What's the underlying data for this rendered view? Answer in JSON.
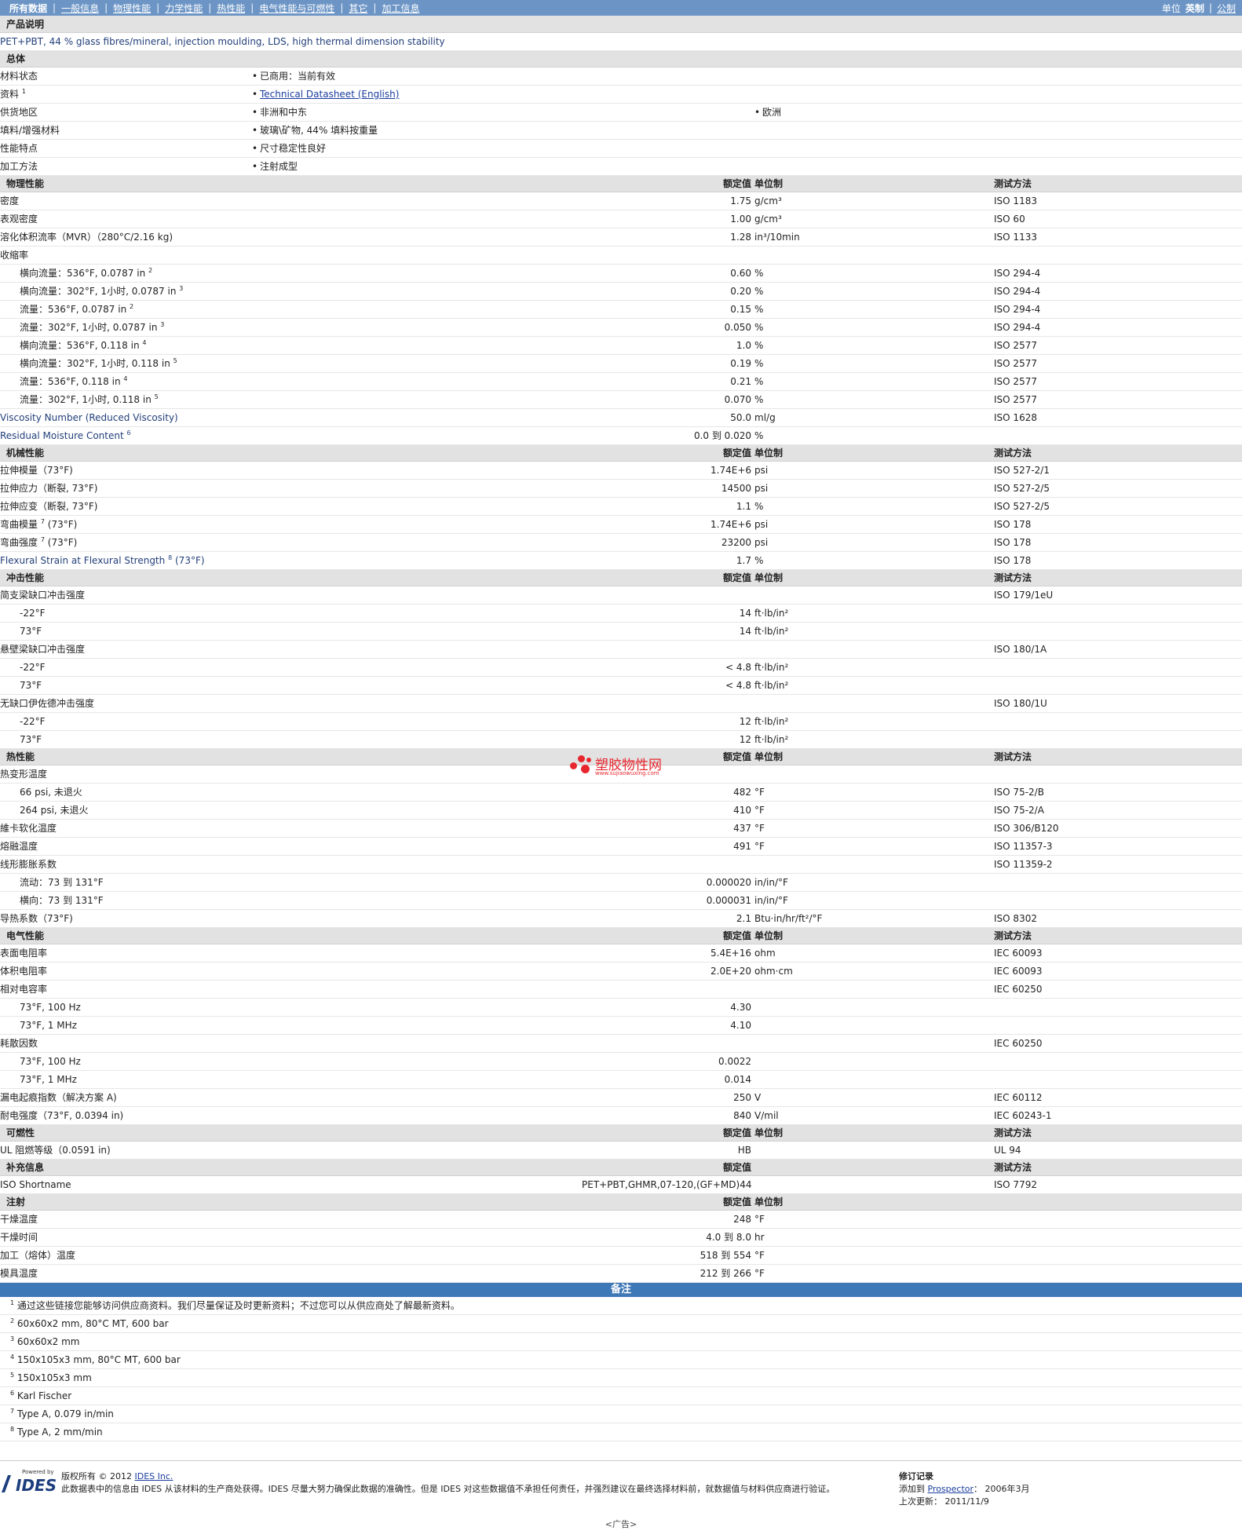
{
  "nav": {
    "tabs": [
      "所有数据",
      "一般信息",
      "物理性能",
      "力学性能",
      "热性能",
      "电气性能与可燃性",
      "其它",
      "加工信息"
    ],
    "units_label": "单位",
    "unit_active": "英制",
    "unit_alt": "公制"
  },
  "header": {
    "value": "额定值",
    "unit": "单位制",
    "method": "测试方法"
  },
  "product": {
    "title": "产品说明",
    "desc": "PET+PBT, 44 % glass fibres/mineral, injection moulding, LDS, high thermal dimension stability"
  },
  "general": {
    "title": "总体",
    "rows": [
      {
        "label": "材料状态",
        "sup": "",
        "v1": "已商用：当前有效",
        "v2": ""
      },
      {
        "label": "资料",
        "sup": "1",
        "v1": "Technical Datasheet (English)",
        "v2": ""
      },
      {
        "label": "供货地区",
        "sup": "",
        "v1": "非洲和中东",
        "v2": "欧洲"
      },
      {
        "label": "填料/增强材料",
        "sup": "",
        "v1": "玻璃\\矿物, 44% 填料按重量",
        "v2": ""
      },
      {
        "label": "性能特点",
        "sup": "",
        "v1": "尺寸稳定性良好",
        "v2": ""
      },
      {
        "label": "加工方法",
        "sup": "",
        "v1": "注射成型",
        "v2": ""
      }
    ]
  },
  "sections": [
    {
      "title": "物理性能",
      "showUnit": true,
      "rows": [
        {
          "label": "密度",
          "value": "1.75",
          "unit": "g/cm³",
          "method": "ISO 1183"
        },
        {
          "label": "表观密度",
          "value": "1.00",
          "unit": "g/cm³",
          "method": "ISO 60"
        },
        {
          "label": "溶化体积流率（MVR）（280°C/2.16 kg)",
          "value": "1.28",
          "unit": "in³/10min",
          "method": "ISO 1133"
        },
        {
          "label": "收缩率",
          "value": "",
          "unit": "",
          "method": ""
        },
        {
          "label": "横向流量：536°F, 0.0787 in",
          "sup": "2",
          "value": "0.60",
          "unit": "%",
          "method": "ISO 294-4",
          "indent": true
        },
        {
          "label": "横向流量：302°F, 1小时, 0.0787 in",
          "sup": "3",
          "value": "0.20",
          "unit": "%",
          "method": "ISO 294-4",
          "indent": true
        },
        {
          "label": "流量：536°F, 0.0787 in",
          "sup": "2",
          "value": "0.15",
          "unit": "%",
          "method": "ISO 294-4",
          "indent": true
        },
        {
          "label": "流量：302°F, 1小时, 0.0787 in",
          "sup": "3",
          "value": "0.050",
          "unit": "%",
          "method": "ISO 294-4",
          "indent": true
        },
        {
          "label": "横向流量：536°F, 0.118 in",
          "sup": "4",
          "value": "1.0",
          "unit": "%",
          "method": "ISO 2577",
          "indent": true
        },
        {
          "label": "横向流量：302°F, 1小时, 0.118 in",
          "sup": "5",
          "value": "0.19",
          "unit": "%",
          "method": "ISO 2577",
          "indent": true
        },
        {
          "label": "流量：536°F, 0.118 in",
          "sup": "4",
          "value": "0.21",
          "unit": "%",
          "method": "ISO 2577",
          "indent": true
        },
        {
          "label": "流量：302°F, 1小时, 0.118 in",
          "sup": "5",
          "value": "0.070",
          "unit": "%",
          "method": "ISO 2577",
          "indent": true
        },
        {
          "label": "Viscosity Number (Reduced Viscosity)",
          "value": "50.0",
          "unit": "ml/g",
          "method": "ISO 1628",
          "blue": true
        },
        {
          "label": "Residual Moisture Content",
          "sup": "6",
          "value": "0.0 到  0.020",
          "unit": "%",
          "method": "",
          "blue": true
        }
      ]
    },
    {
      "title": "机械性能",
      "showUnit": true,
      "rows": [
        {
          "label": "拉伸模量（73°F)",
          "value": "1.74E+6",
          "unit": "psi",
          "method": "ISO 527-2/1"
        },
        {
          "label": "拉伸应力（断裂, 73°F)",
          "value": "14500",
          "unit": "psi",
          "method": "ISO 527-2/5"
        },
        {
          "label": "拉伸应变（断裂, 73°F)",
          "value": "1.1",
          "unit": "%",
          "method": "ISO 527-2/5"
        },
        {
          "label": "弯曲模量",
          "sup": "7",
          "label2": "(73°F)",
          "value": "1.74E+6",
          "unit": "psi",
          "method": "ISO 178"
        },
        {
          "label": "弯曲强度",
          "sup": "7",
          "label2": "(73°F)",
          "value": "23200",
          "unit": "psi",
          "method": "ISO 178"
        },
        {
          "label": "Flexural Strain at Flexural Strength",
          "sup": "8",
          "label2": "(73°F)",
          "value": "1.7",
          "unit": "%",
          "method": "ISO 178",
          "blue": true
        }
      ]
    },
    {
      "title": "冲击性能",
      "showUnit": true,
      "rows": [
        {
          "label": "简支梁缺口冲击强度",
          "value": "",
          "unit": "",
          "method": "ISO 179/1eU"
        },
        {
          "label": "-22°F",
          "value": "14",
          "unit": "ft·lb/in²",
          "method": "",
          "indent": true
        },
        {
          "label": "73°F",
          "value": "14",
          "unit": "ft·lb/in²",
          "method": "",
          "indent": true
        },
        {
          "label": "悬壁梁缺口冲击强度",
          "value": "",
          "unit": "",
          "method": "ISO 180/1A"
        },
        {
          "label": "-22°F",
          "value": "< 4.8",
          "unit": "ft·lb/in²",
          "method": "",
          "indent": true
        },
        {
          "label": "73°F",
          "value": "< 4.8",
          "unit": "ft·lb/in²",
          "method": "",
          "indent": true
        },
        {
          "label": "无缺口伊佐德冲击强度",
          "value": "",
          "unit": "",
          "method": "ISO 180/1U"
        },
        {
          "label": "-22°F",
          "value": "12",
          "unit": "ft·lb/in²",
          "method": "",
          "indent": true
        },
        {
          "label": "73°F",
          "value": "12",
          "unit": "ft·lb/in²",
          "method": "",
          "indent": true
        }
      ]
    },
    {
      "title": "热性能",
      "showUnit": true,
      "rows": [
        {
          "label": "热变形温度",
          "value": "",
          "unit": "",
          "method": ""
        },
        {
          "label": "66 psi, 未退火",
          "value": "482",
          "unit": "°F",
          "method": "ISO 75-2/B",
          "indent": true
        },
        {
          "label": "264 psi, 未退火",
          "value": "410",
          "unit": "°F",
          "method": "ISO 75-2/A",
          "indent": true
        },
        {
          "label": "維卡软化温度",
          "value": "437",
          "unit": "°F",
          "method": "ISO 306/B120"
        },
        {
          "label": "熔融温度",
          "value": "491",
          "unit": "°F",
          "method": "ISO 11357-3"
        },
        {
          "label": "线形膨胀系数",
          "value": "",
          "unit": "",
          "method": "ISO 11359-2"
        },
        {
          "label": "流动：73 到  131°F",
          "value": "0.000020",
          "unit": "in/in/°F",
          "method": "",
          "indent": true
        },
        {
          "label": "横向：73 到  131°F",
          "value": "0.000031",
          "unit": "in/in/°F",
          "method": "",
          "indent": true
        },
        {
          "label": "导热系数（73°F)",
          "value": "2.1",
          "unit": "Btu·in/hr/ft²/°F",
          "method": "ISO 8302"
        }
      ]
    },
    {
      "title": "电气性能",
      "showUnit": true,
      "rows": [
        {
          "label": "表面电阻率",
          "value": "5.4E+16",
          "unit": "ohm",
          "method": "IEC 60093"
        },
        {
          "label": "体积电阻率",
          "value": "2.0E+20",
          "unit": "ohm·cm",
          "method": "IEC 60093"
        },
        {
          "label": "相对电容率",
          "value": "",
          "unit": "",
          "method": "IEC 60250"
        },
        {
          "label": "73°F, 100 Hz",
          "value": "4.30",
          "unit": "",
          "method": "",
          "indent": true
        },
        {
          "label": "73°F, 1 MHz",
          "value": "4.10",
          "unit": "",
          "method": "",
          "indent": true
        },
        {
          "label": "耗散因数",
          "value": "",
          "unit": "",
          "method": "IEC 60250"
        },
        {
          "label": "73°F, 100 Hz",
          "value": "0.0022",
          "unit": "",
          "method": "",
          "indent": true
        },
        {
          "label": "73°F, 1 MHz",
          "value": "0.014",
          "unit": "",
          "method": "",
          "indent": true
        },
        {
          "label": "漏电起痕指数（解决方案 A)",
          "value": "250",
          "unit": "V",
          "method": "IEC 60112"
        },
        {
          "label": "耐电强度（73°F, 0.0394 in)",
          "value": "840",
          "unit": "V/mil",
          "method": "IEC 60243-1"
        }
      ]
    },
    {
      "title": "可燃性",
      "showUnit": true,
      "rows": [
        {
          "label": "UL 阻燃等级（0.0591 in)",
          "value": "HB",
          "unit": "",
          "method": "UL 94"
        }
      ]
    },
    {
      "title": "补充信息",
      "showUnit": false,
      "rows": [
        {
          "label": "ISO Shortname",
          "value": "PET+PBT,GHMR,07-120,(GF+MD)44",
          "unit": "",
          "method": "ISO 7792"
        }
      ]
    },
    {
      "title": "注射",
      "showUnit": true,
      "showMethod": false,
      "rows": [
        {
          "label": "干燥温度",
          "value": "248",
          "unit": "°F",
          "method": ""
        },
        {
          "label": "干燥时间",
          "value": "4.0 到  8.0",
          "unit": "hr",
          "method": ""
        },
        {
          "label": "加工（熔体）温度",
          "value": "518 到  554",
          "unit": "°F",
          "method": ""
        },
        {
          "label": "模具温度",
          "value": "212 到  266",
          "unit": "°F",
          "method": ""
        }
      ]
    }
  ],
  "notes": {
    "title": "备注",
    "items": [
      {
        "n": "1",
        "text": "通过这些链接您能够访问供应商资料。我们尽量保证及时更新资料；不过您可以从供应商处了解最新资料。"
      },
      {
        "n": "2",
        "text": "60x60x2 mm, 80°C MT, 600 bar"
      },
      {
        "n": "3",
        "text": "60x60x2 mm"
      },
      {
        "n": "4",
        "text": "150x105x3 mm, 80°C MT, 600 bar"
      },
      {
        "n": "5",
        "text": "150x105x3 mm"
      },
      {
        "n": "6",
        "text": "Karl Fischer"
      },
      {
        "n": "7",
        "text": "Type A, 0.079 in/min"
      },
      {
        "n": "8",
        "text": "Type A, 2 mm/min"
      }
    ]
  },
  "footer": {
    "logo_small": "Powered by",
    "logo_big": "IDES",
    "copyright_pre": "版权所有  © 2012 ",
    "copyright_link": "IDES Inc.",
    "disclaimer": "此数据表中的信息由  IDES 从该材料的生产商处获得。IDES 尽量大努力确保此数据的准确性。但是  IDES 对这些数据值不承担任何责任，并强烈建议在最终选择材料前，就数据值与材料供应商进行验证。",
    "rev_title": "修订记录",
    "rev_added_label": "添加到  ",
    "rev_added_link": "Prospector",
    "rev_added_date": "：  2006年3月",
    "rev_updated": "上次更新：  2011/11/9",
    "ad": "<广告>"
  },
  "watermark": {
    "text": "塑胶物性网",
    "url": "www.sujiaowuxing.com"
  },
  "colors": {
    "nav": "#6c95c6",
    "section": "#e2e2e2",
    "notes_bar": "#3f78b7",
    "watermark": "#e8262e"
  }
}
